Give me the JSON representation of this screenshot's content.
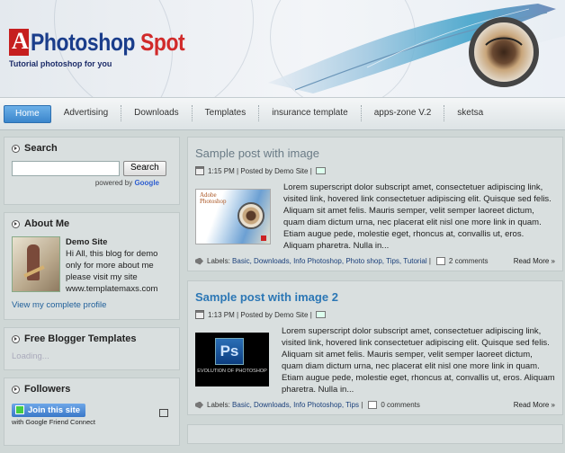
{
  "header": {
    "logo_main": "Photoshop",
    "logo_accent": "Spot",
    "tagline": "Tutorial photoshop for you"
  },
  "nav": {
    "items": [
      "Home",
      "Advertising",
      "Downloads",
      "Templates",
      "insurance template",
      "apps-zone V.2",
      "sketsa"
    ]
  },
  "sidebar": {
    "search": {
      "title": "Search",
      "button": "Search",
      "powered_by": "powered by",
      "powered_brand": "Google"
    },
    "about": {
      "title": "About Me",
      "name": "Demo Site",
      "description": "Hi All, this blog for demo only for more about me please visit my site www.templatemaxs.com",
      "profile_link": "View my complete profile"
    },
    "free_templates": {
      "title": "Free Blogger Templates",
      "status": "Loading..."
    },
    "followers": {
      "title": "Followers",
      "join": "Join this site",
      "gfc": "with Google Friend Connect"
    }
  },
  "posts": [
    {
      "title": "Sample post with image",
      "time": "1:15 PM",
      "posted_by": "Posted by Demo Site",
      "body": "Lorem superscript dolor subscript amet, consectetuer adipiscing link, visited link, hovered link consectetuer adipiscing elit. Quisque sed felis. Aliquam sit amet felis. Mauris semper, velit semper laoreet dictum, quam diam dictum urna, nec placerat elit nisl one more link in quam. Etiam augue pede, molestie eget, rhoncus at, convallis ut, eros. Aliquam pharetra. Nulla in...",
      "labels_prefix": "Labels:",
      "labels": "Basic, Downloads, Info Photoshop, Photo shop, Tips, Tutorial",
      "comments": "2 comments",
      "read_more": "Read More »"
    },
    {
      "title": "Sample post with image 2",
      "time": "1:13 PM",
      "posted_by": "Posted by Demo Site",
      "body": "Lorem superscript dolor subscript amet, consectetuer adipiscing link, visited link, hovered link consectetuer adipiscing elit. Quisque sed felis. Aliquam sit amet felis. Mauris semper, velit semper laoreet dictum, quam diam dictum urna, nec placerat elit nisl one more link in quam. Etiam augue pede, molestie eget, rhoncus at, convallis ut, eros. Aliquam pharetra. Nulla in...",
      "labels_prefix": "Labels:",
      "labels": "Basic, Downloads, Info Photoshop, Tips",
      "comments": "0 comments",
      "read_more": "Read More »",
      "thumb_title": "EVOLUTION OF PHOTOSHOP"
    }
  ],
  "colors": {
    "nav_active": "#3b86cc",
    "post_title_link": "#2c77b5",
    "logo_blue": "#1a3d8b",
    "logo_red": "#d12a2a"
  }
}
